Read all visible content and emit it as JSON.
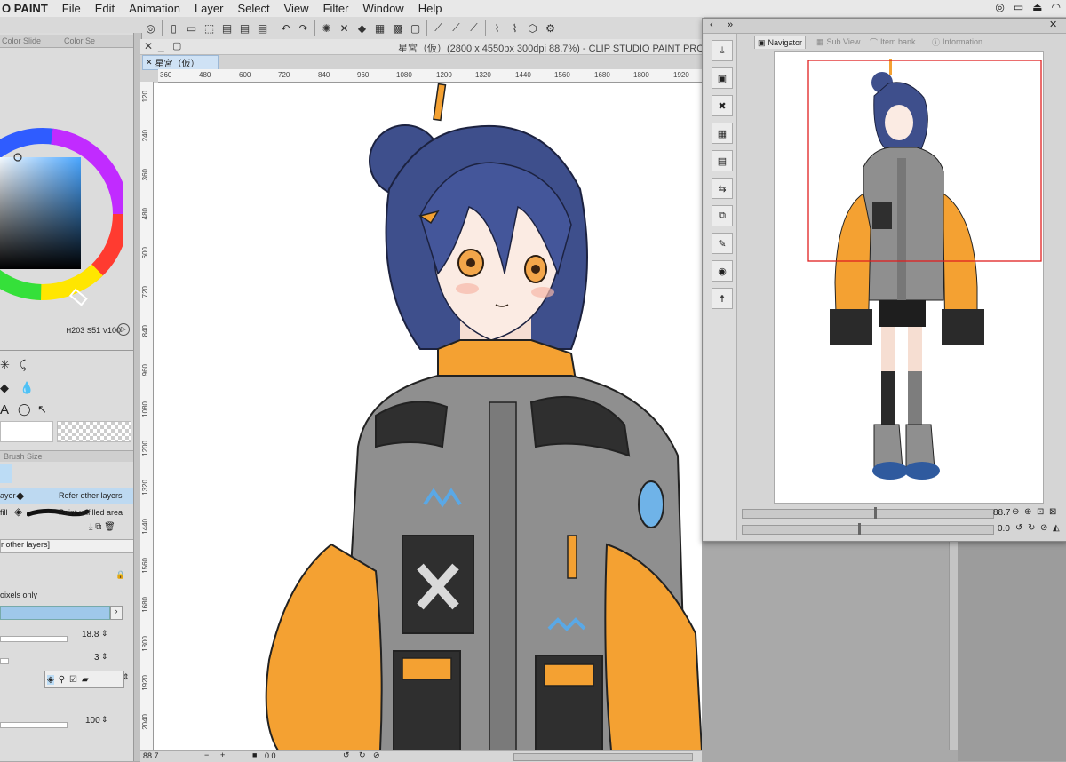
{
  "menubar": {
    "app_name": "O PAINT",
    "items": [
      "File",
      "Edit",
      "Animation",
      "Layer",
      "Select",
      "View",
      "Filter",
      "Window",
      "Help"
    ]
  },
  "left_panel": {
    "tabs": [
      "Color Slide",
      "Color Se"
    ],
    "color_values": {
      "h": "203",
      "s": "51",
      "v": "100"
    },
    "brush_size_tab": "Brush Size",
    "refer_label": "Refer other layers",
    "paint_label": "Paint unfilled area",
    "layer_label": "ayer",
    "fill_label": "fill",
    "refer_other_layers_tag": "r other layers]",
    "pixels_only_label": "oixels only",
    "value_1": "18.8",
    "value_2": "3",
    "value_3": "100"
  },
  "document": {
    "title": "星宮（仮）(2800 x 4550px 300dpi 88.7%)  - CLIP STUDIO PAINT PRO",
    "tab_label": "星宮（仮）",
    "h_ruler_ticks": [
      "360",
      "480",
      "600",
      "720",
      "840",
      "960",
      "1080",
      "1200",
      "1320",
      "1440",
      "1560",
      "1680",
      "1800",
      "1920"
    ],
    "v_ruler_ticks": [
      "120",
      "240",
      "360",
      "480",
      "600",
      "720",
      "840",
      "960",
      "1080",
      "1200",
      "1320",
      "1440",
      "1560",
      "1680",
      "1800",
      "1920",
      "2040"
    ],
    "status_zoom": "88.7",
    "status_angle": "0.0"
  },
  "navigator": {
    "tabs": [
      "Navigator",
      "Sub View",
      "Item bank",
      "Information"
    ],
    "zoom_value": "88.7",
    "rotate_value": "0.0"
  },
  "colors": {
    "accent_selected": "#8ec5f0",
    "jacket_orange": "#f4a132",
    "hair_blue": "#3e4f8c",
    "jacket_gray": "#8f8f8f",
    "viewport_rect": "#e02020"
  }
}
